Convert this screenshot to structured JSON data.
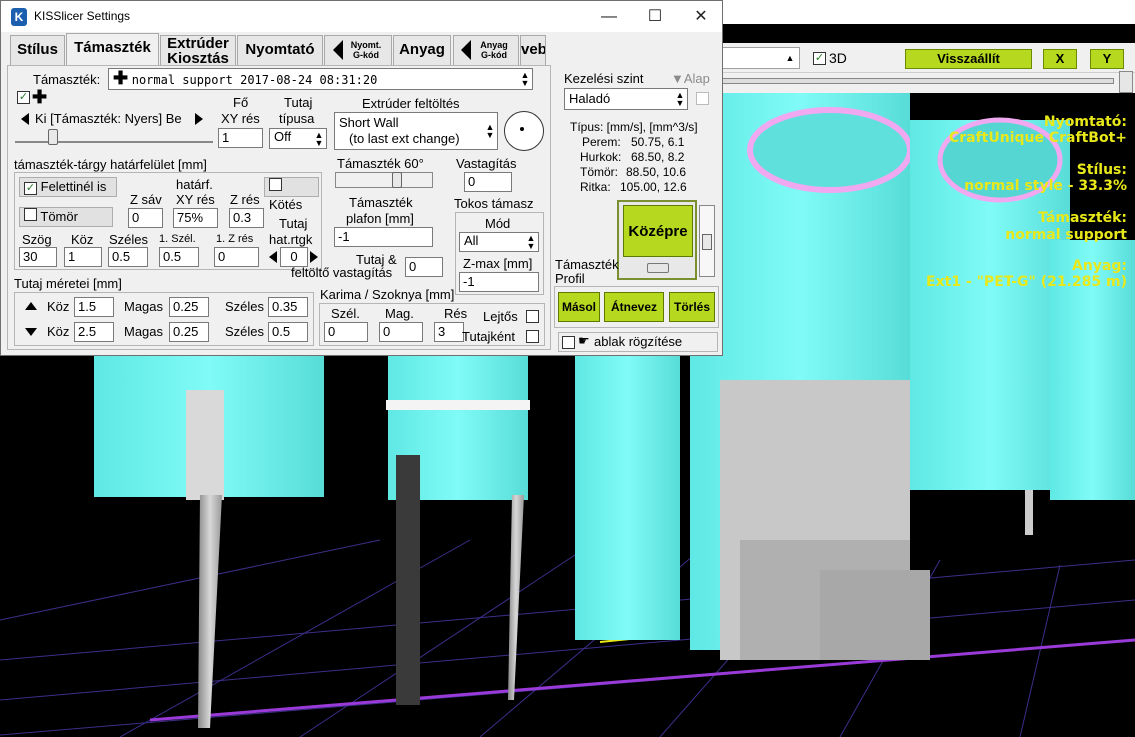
{
  "window": {
    "title": "KISSlicer Settings",
    "minimize": "—",
    "maximize": "☐",
    "close": "✕"
  },
  "tabs": [
    {
      "label": "Stílus"
    },
    {
      "label": "Támaszték"
    },
    {
      "label": "Extrúder Kiosztás"
    },
    {
      "label": "Nyomtató"
    },
    {
      "label": "Nyomt. G-kód"
    },
    {
      "label": "Anyag"
    },
    {
      "label": "Anyag G-kód"
    },
    {
      "label": "Bővebb"
    }
  ],
  "support": {
    "profile_label": "Támaszték:",
    "profile_value": "normal support  2017-08-24 08:31:20",
    "slider_label": "Ki [Támaszték: Nyers] Be",
    "main_xy_label_1": "Fő",
    "main_xy_label_2": "XY rés",
    "main_xy_value": "1",
    "raft_type_label_1": "Tutaj",
    "raft_type_label_2": "típusa",
    "raft_type_value": "Off",
    "extruder_fill_label": "Extrúder feltöltés",
    "extruder_fill_line1": "Short Wall",
    "extruder_fill_line2": "(to last ext change)",
    "interface_label": "támaszték-tárgy határfelület [mm]",
    "above_only_label": "Felettinél is",
    "above_only_checked": true,
    "solid_label": "Tömör",
    "solid_checked": false,
    "bond_label": "Kötés",
    "bond_checked": false,
    "z_band_label": "Z sáv",
    "z_band_value": "0",
    "limit_xy_label_1": "határf.",
    "limit_xy_label_2": "XY rés",
    "limit_xy_value": "75%",
    "z_gap_label": "Z rés",
    "z_gap_value": "0.3",
    "raft_layers_label_1": "Tutaj",
    "raft_layers_label_2": "hat.rtgk",
    "raft_layers_value": "0",
    "angle_label": "Szög",
    "angle_value": "30",
    "gap_label": "Köz",
    "gap_value": "1",
    "width_label": "Széles",
    "width_value": "0.5",
    "first_width_label": "1. Szél.",
    "first_width_value": "0.5",
    "first_z_label": "1. Z rés",
    "first_z_value": "0",
    "support60_label": "Támaszték 60°",
    "thickness_label": "Vastagítás",
    "thickness_value": "0",
    "ceiling_label_1": "Támaszték",
    "ceiling_label_2": "plafon [mm]",
    "ceiling_value": "-1",
    "tokos_label": "Tokos támasz",
    "mode_label": "Mód",
    "mode_value": "All",
    "zmax_label": "Z-max [mm]",
    "zmax_value": "-1",
    "raft_fill_label_1": "Tutaj &",
    "raft_fill_label_2": "feltöltő vastagítás",
    "raft_fill_value": "0",
    "raft_size_label": "Tutaj méretei [mm]",
    "raft_top": {
      "gap_label": "Köz",
      "gap": "1.5",
      "height_label": "Magas",
      "height": "0.25",
      "width_label": "Széles",
      "width": "0.35"
    },
    "raft_bottom": {
      "gap_label": "Köz",
      "gap": "2.5",
      "height_label": "Magas",
      "height": "0.25",
      "width_label": "Széles",
      "width": "0.5"
    },
    "brim_label": "Karima / Szoknya [mm]",
    "brim_width_label": "Szél.",
    "brim_width_value": "0",
    "brim_height_label": "Mag.",
    "brim_height_value": "0",
    "brim_gap_label": "Rés",
    "brim_gap_value": "3",
    "slope_label": "Lejtős",
    "slope_checked": false,
    "as_raft_label": "Tutajként",
    "as_raft_checked": false
  },
  "right_panel": {
    "level_label": "Kezelési szint",
    "default_label": "Alap",
    "level_value": "Haladó",
    "speeds_header": "Típus: [mm/s], [mm^3/s]",
    "speeds": [
      {
        "label": "Perem:",
        "value": "50.75,  6.1"
      },
      {
        "label": "Hurkok:",
        "value": "68.50,  8.2"
      },
      {
        "label": "Tömör:",
        "value": "88.50, 10.6"
      },
      {
        "label": "Ritka:",
        "value": "105.00, 12.6"
      }
    ],
    "center_button": "Középre",
    "profile_label_1": "Támaszték",
    "profile_label_2": "Profil",
    "copy_button": "Másol",
    "rename_button": "Átnevez",
    "delete_button": "Törlés",
    "pin_label": "ablak rögzítése"
  },
  "app": {
    "show_3d_label": "3D",
    "reset_button": "Visszaállít",
    "x_button": "X",
    "y_button": "Y"
  },
  "overlay": {
    "printer_label": "Nyomtató:",
    "printer_value": "CraftUnique CraftBot+",
    "style_label": "Stílus:",
    "style_value": "normal style -  33.3%",
    "support_label": "Támaszték:",
    "support_value": "normal support",
    "material_label": "Anyag:",
    "material_value": "Ext1 - \"PET-G\" (21.285 m)"
  },
  "colors": {
    "accent": "#b6d920",
    "overlay_text": "#e8e81a",
    "model_cyan": "#6ff6f2",
    "model_pink": "#f0a8f0",
    "grid": "#6b56d8"
  }
}
